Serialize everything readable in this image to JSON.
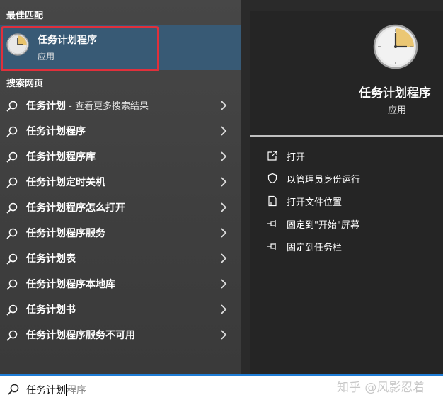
{
  "best_match": {
    "section_title": "最佳匹配",
    "title": "任务计划程序",
    "subtitle": "应用"
  },
  "web": {
    "section_title": "搜索网页",
    "items": [
      {
        "main": "任务计划",
        "extra": " - 查看更多搜索结果"
      },
      {
        "main": "任务计划程序",
        "extra": ""
      },
      {
        "main": "任务计划程序库",
        "extra": ""
      },
      {
        "main": "任务计划定时关机",
        "extra": ""
      },
      {
        "main": "任务计划程序怎么打开",
        "extra": ""
      },
      {
        "main": "任务计划程序服务",
        "extra": ""
      },
      {
        "main": "任务计划表",
        "extra": ""
      },
      {
        "main": "任务计划程序本地库",
        "extra": ""
      },
      {
        "main": "任务计划书",
        "extra": ""
      },
      {
        "main": "任务计划程序服务不可用",
        "extra": ""
      }
    ]
  },
  "detail": {
    "title": "任务计划程序",
    "subtitle": "应用",
    "actions": [
      {
        "label": "打开",
        "icon": "open-icon"
      },
      {
        "label": "以管理员身份运行",
        "icon": "shield-icon"
      },
      {
        "label": "打开文件位置",
        "icon": "file-location-icon"
      },
      {
        "label": "固定到\"开始\"屏幕",
        "icon": "pin-icon"
      },
      {
        "label": "固定到任务栏",
        "icon": "pin-icon"
      }
    ]
  },
  "search": {
    "typed": "任务计划",
    "suggestion": "程序"
  },
  "watermark": "知乎 @风影忍着",
  "colors": {
    "selection": "#385a75",
    "highlight_border": "#e0303b",
    "search_focus": "#1f7dd6"
  }
}
